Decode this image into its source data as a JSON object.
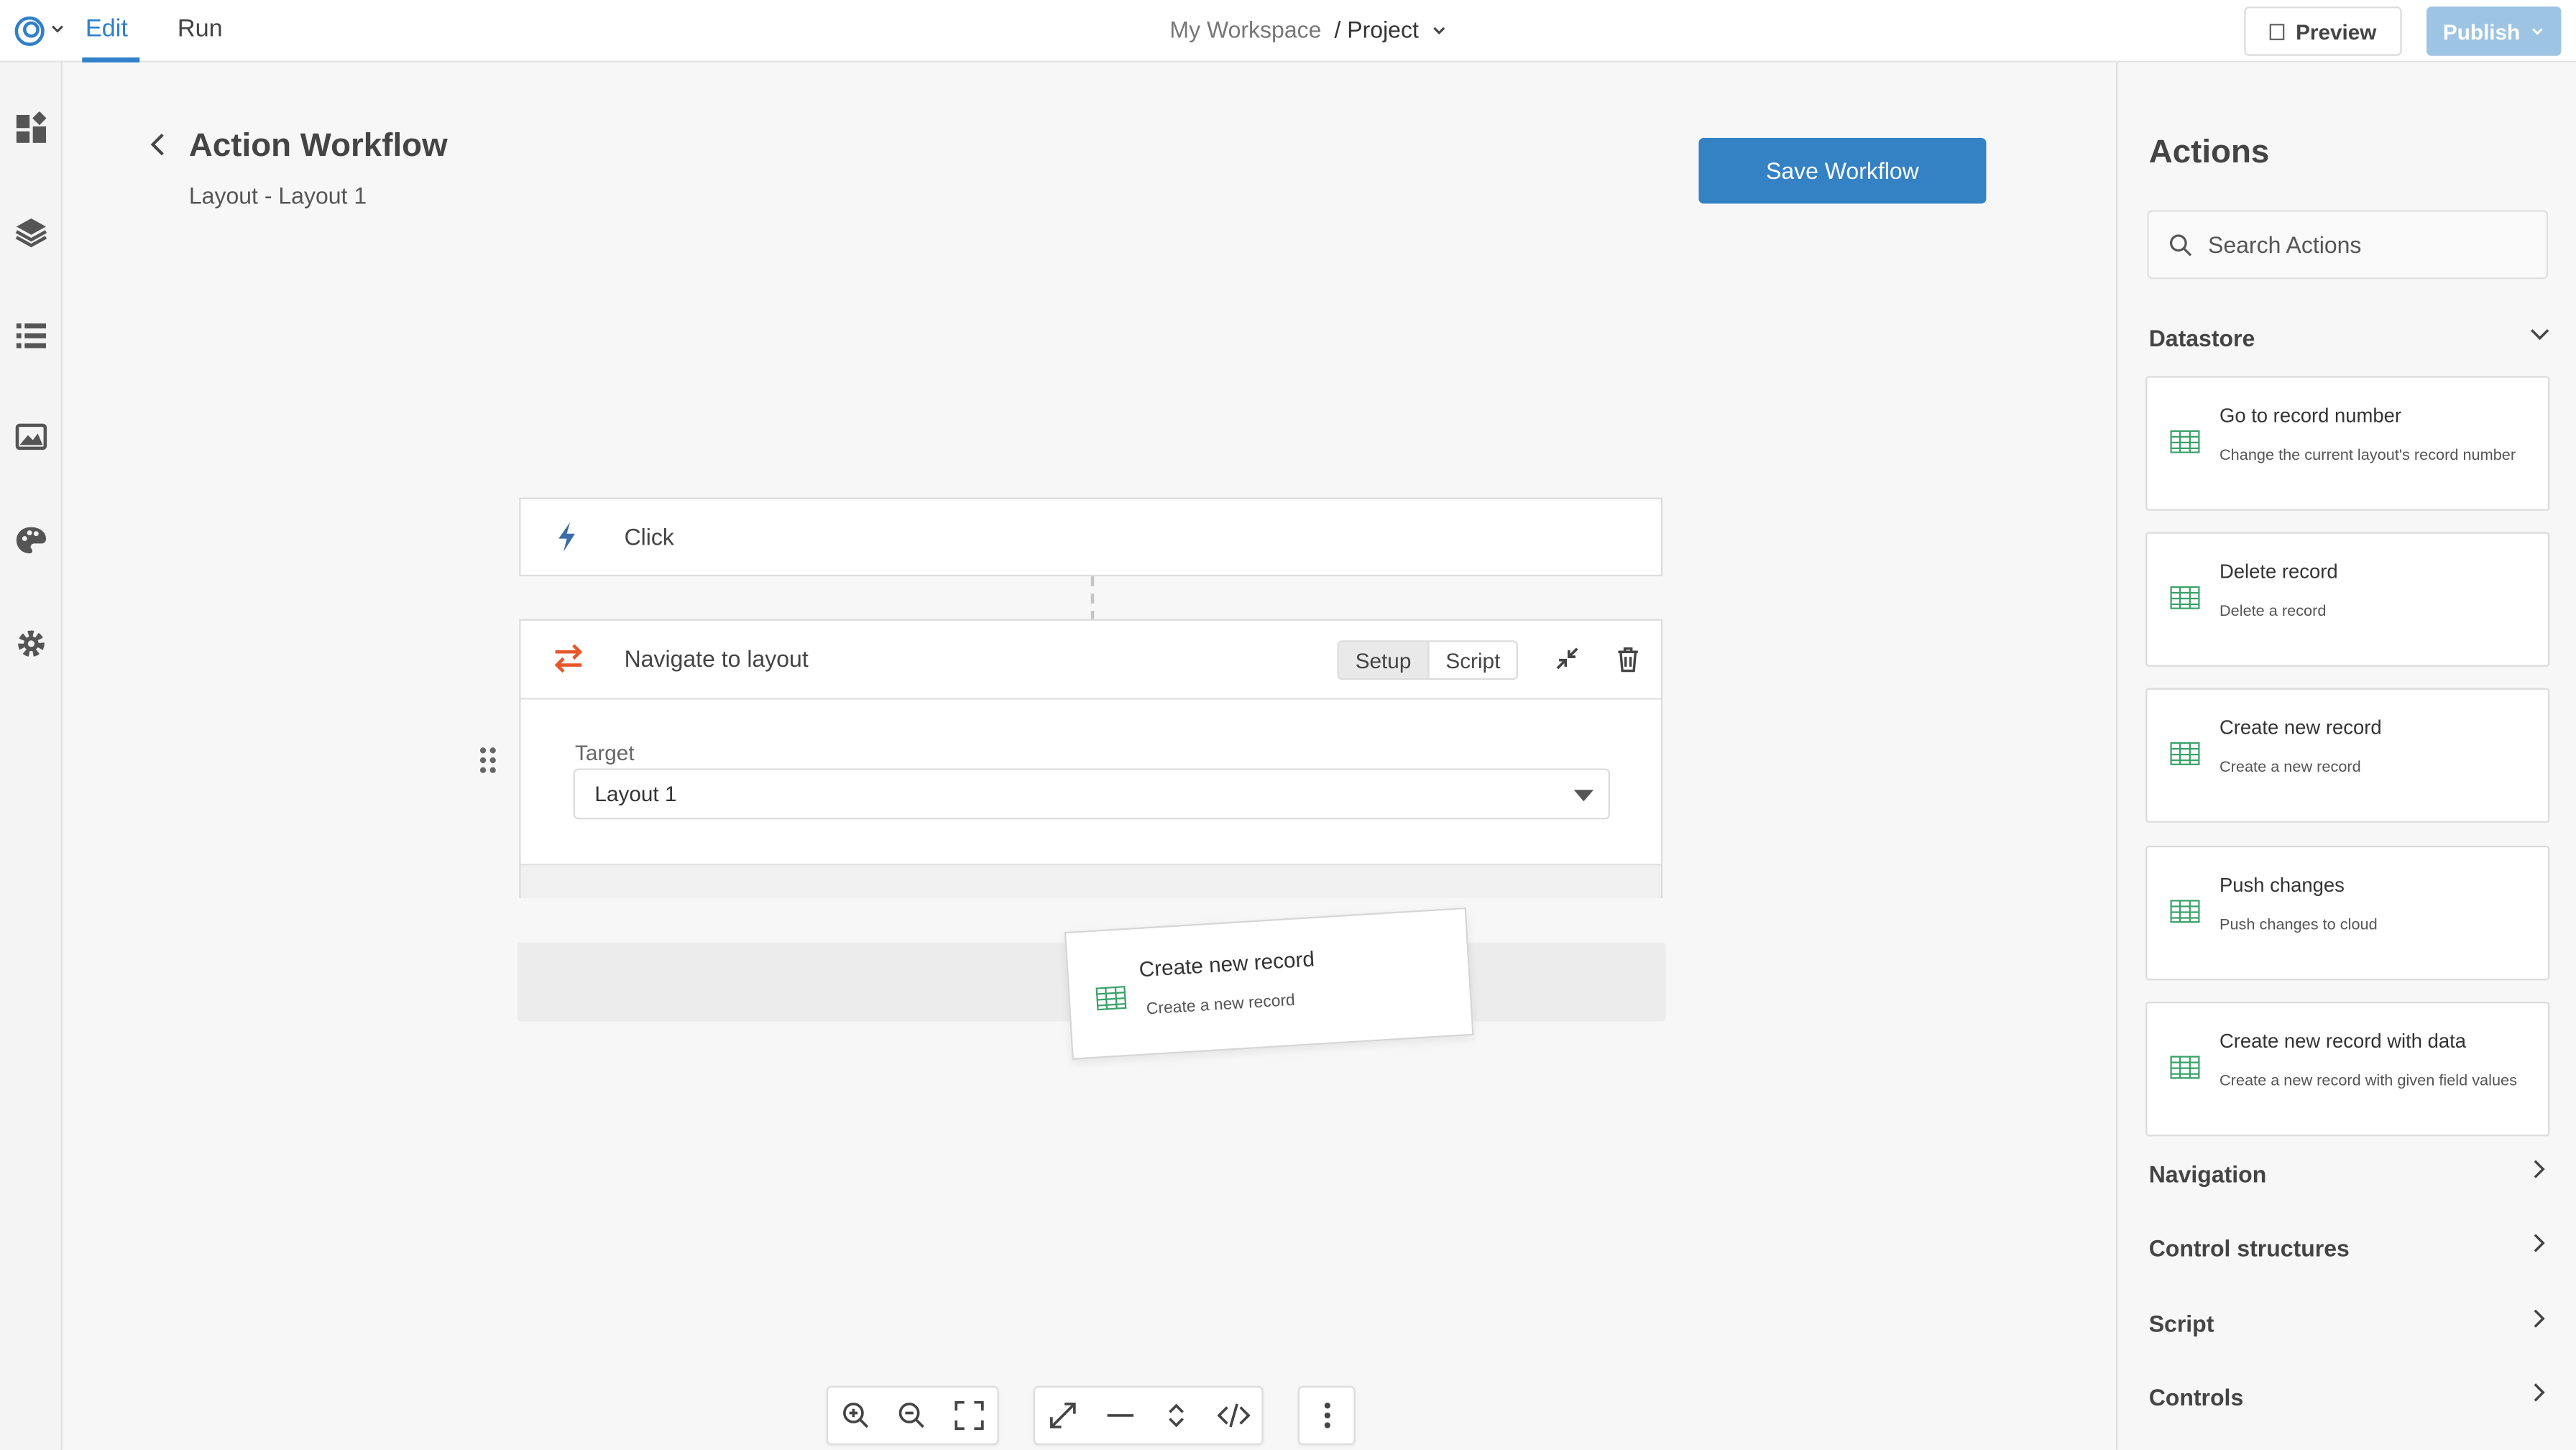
{
  "topbar": {
    "tabs": [
      {
        "label": "Edit",
        "active": true
      },
      {
        "label": "Run",
        "active": false
      }
    ],
    "breadcrumb": {
      "workspace": "My Workspace",
      "project": "/ Project"
    },
    "preview_label": "Preview",
    "publish_label": "Publish"
  },
  "rail": {
    "icons": [
      "dashboard-icon",
      "layers-icon",
      "list-icon",
      "image-icon",
      "palette-icon",
      "gear-icon"
    ]
  },
  "workflow": {
    "title": "Action Workflow",
    "subtitle": "Layout - Layout 1",
    "save_label": "Save Workflow",
    "trigger": {
      "label": "Click"
    },
    "step": {
      "label": "Navigate to layout",
      "tabs": [
        "Setup",
        "Script"
      ],
      "target_label": "Target",
      "target_value": "Layout 1"
    },
    "drag_ghost": {
      "title": "Create new record",
      "description": "Create a new record"
    }
  },
  "panel": {
    "title": "Actions",
    "search_placeholder": "Search Actions",
    "sections": {
      "datastore": "Datastore",
      "navigation": "Navigation",
      "control_structures": "Control structures",
      "script": "Script",
      "controls": "Controls"
    },
    "actions": [
      {
        "title": "Go to record number",
        "description": "Change the current layout's record number"
      },
      {
        "title": "Delete record",
        "description": "Delete a record"
      },
      {
        "title": "Create new record",
        "description": "Create a new record"
      },
      {
        "title": "Push changes",
        "description": "Push changes to cloud"
      },
      {
        "title": "Create new record with data",
        "description": "Create a new record with given field values"
      }
    ]
  },
  "colors": {
    "accent": "#3481c4",
    "publish": "#9ec4e4",
    "table_icon": "#3aa169",
    "navigate_icon": "#e8562a"
  }
}
